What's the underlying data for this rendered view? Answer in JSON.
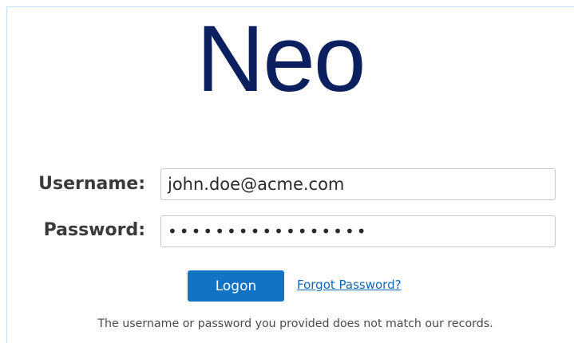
{
  "brand": {
    "logo_text": "Neo",
    "logo_color": "#0c1f5f"
  },
  "form": {
    "username_label": "Username:",
    "username_value": "john.doe@acme.com",
    "password_label": "Password:",
    "password_value": "•••••••••••••••••"
  },
  "actions": {
    "logon_label": "Logon",
    "forgot_password_label": "Forgot Password?",
    "accent_color": "#1173c6"
  },
  "status": {
    "error_message": "The username or password you provided does not match our records."
  }
}
